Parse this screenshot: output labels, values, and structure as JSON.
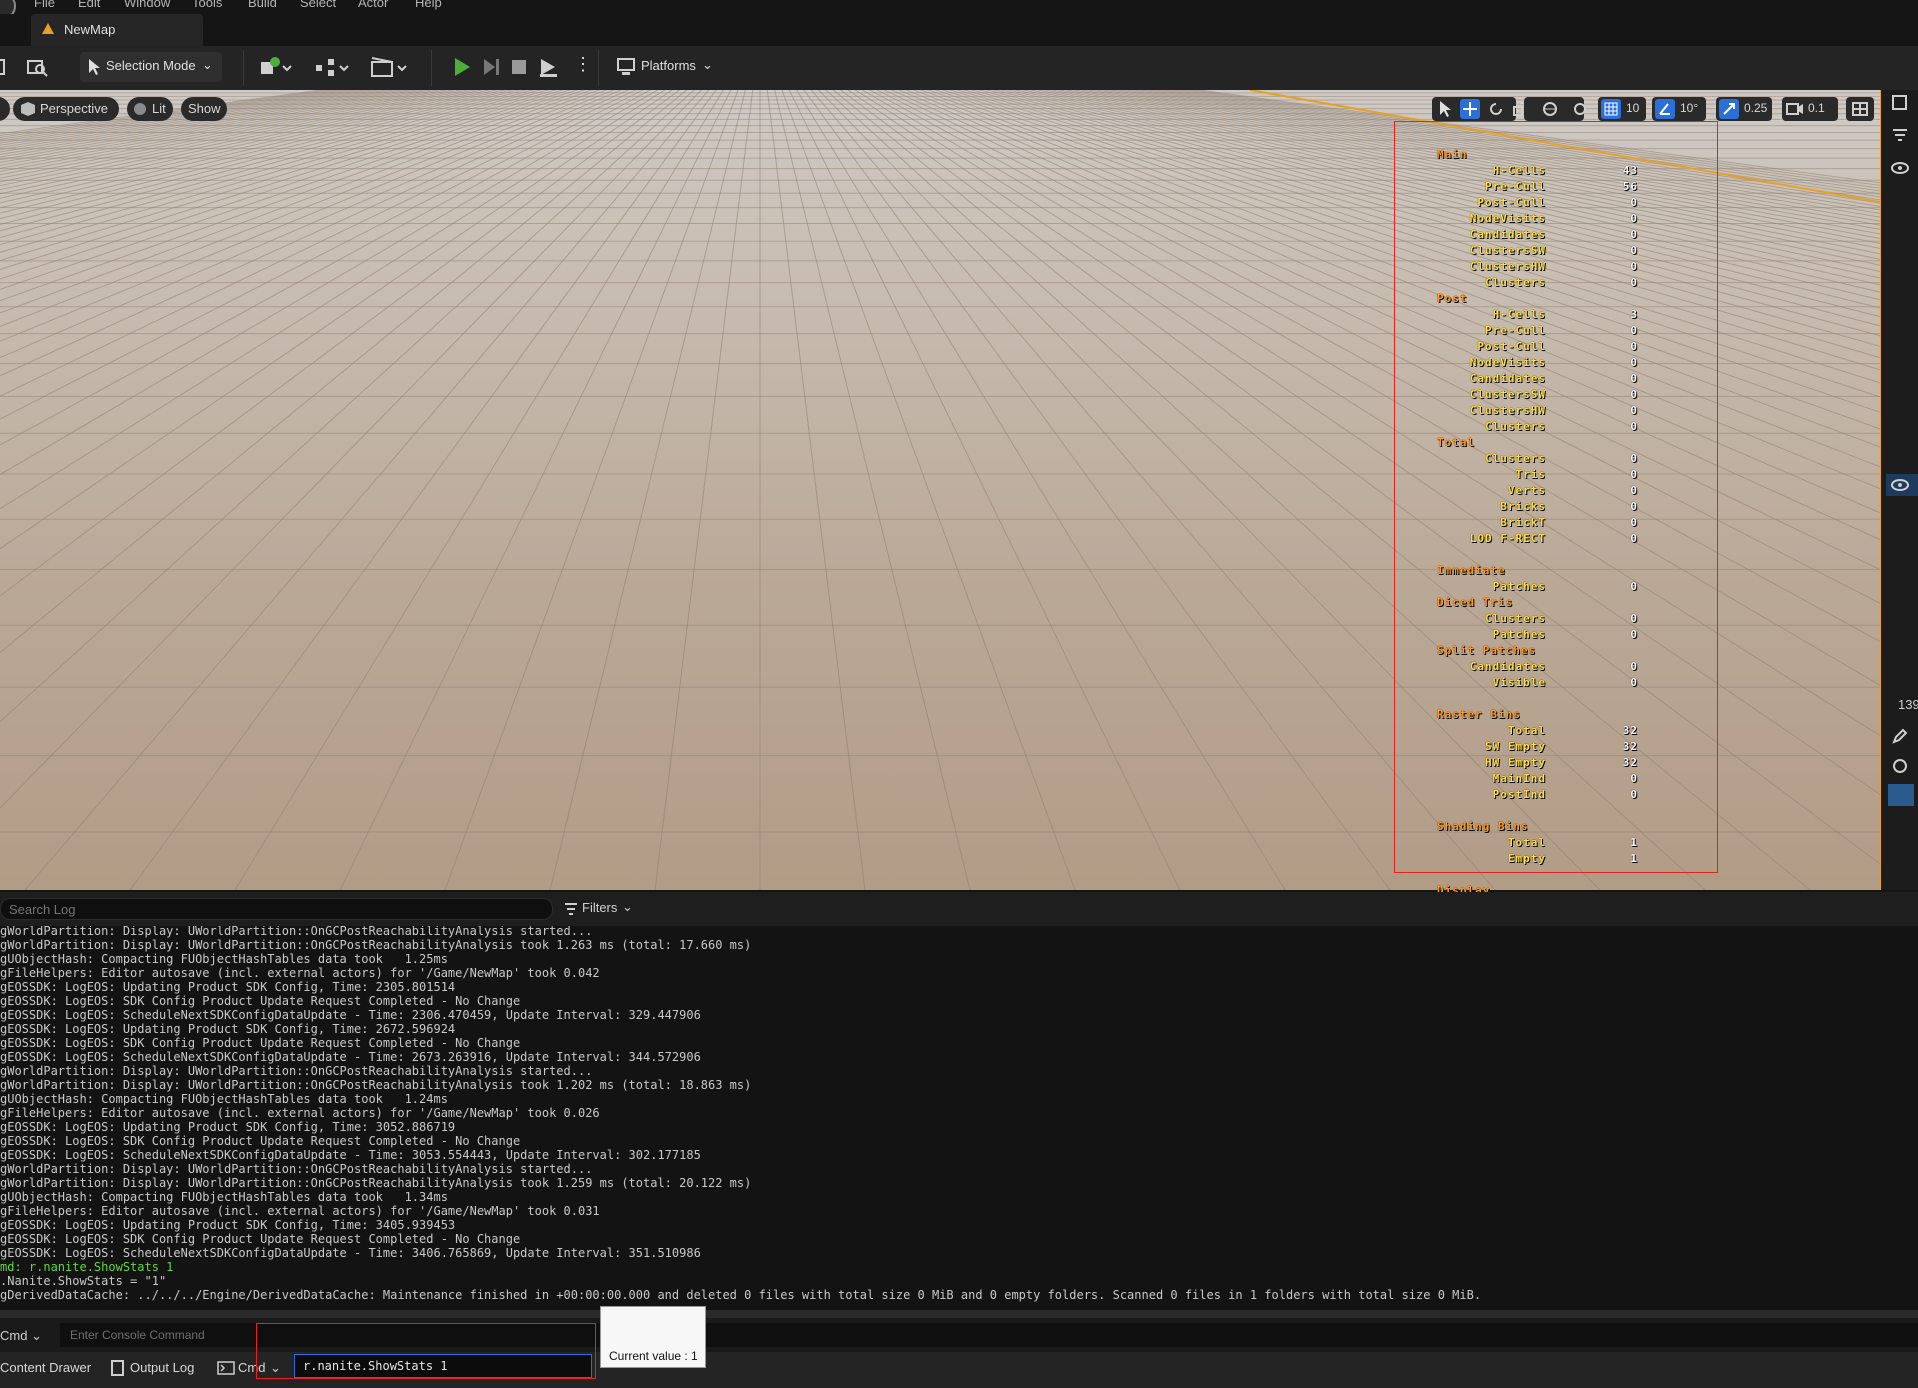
{
  "menu": [
    "File",
    "Edit",
    "Window",
    "Tools",
    "Build",
    "Select",
    "Actor",
    "Help"
  ],
  "tab": {
    "title": "NewMap"
  },
  "toolbar": {
    "selection_mode": "Selection Mode",
    "platforms": "Platforms"
  },
  "viewport": {
    "perspective": "Perspective",
    "lit": "Lit",
    "show": "Show",
    "grid_snap": "10",
    "rotation_snap": "10°",
    "scale_snap": "0.25",
    "camera_speed": "0.1",
    "right_edge_value": "139"
  },
  "stats": [
    {
      "type": "section",
      "label": "Main"
    },
    {
      "type": "row",
      "label": "H-Cells",
      "value": "43"
    },
    {
      "type": "row",
      "label": "Pre-Cull",
      "value": "56"
    },
    {
      "type": "row",
      "label": "Post-Cull",
      "value": "0"
    },
    {
      "type": "row",
      "label": "NodeVisits",
      "value": "0"
    },
    {
      "type": "row",
      "label": "Candidates",
      "value": "0"
    },
    {
      "type": "row",
      "label": "ClustersSW",
      "value": "0"
    },
    {
      "type": "row",
      "label": "ClustersHW",
      "value": "0"
    },
    {
      "type": "row",
      "label": "Clusters",
      "value": "0"
    },
    {
      "type": "section",
      "label": "Post"
    },
    {
      "type": "row",
      "label": "H-Cells",
      "value": "3"
    },
    {
      "type": "row",
      "label": "Pre-Cull",
      "value": "0"
    },
    {
      "type": "row",
      "label": "Post-Cull",
      "value": "0"
    },
    {
      "type": "row",
      "label": "NodeVisits",
      "value": "0"
    },
    {
      "type": "row",
      "label": "Candidates",
      "value": "0"
    },
    {
      "type": "row",
      "label": "ClustersSW",
      "value": "0"
    },
    {
      "type": "row",
      "label": "ClustersHW",
      "value": "0"
    },
    {
      "type": "row",
      "label": "Clusters",
      "value": "0"
    },
    {
      "type": "section",
      "label": "Total"
    },
    {
      "type": "row",
      "label": "Clusters",
      "value": "0"
    },
    {
      "type": "row",
      "label": "Tris",
      "value": "0"
    },
    {
      "type": "row",
      "label": "Verts",
      "value": "0"
    },
    {
      "type": "row",
      "label": "Bricks",
      "value": "0"
    },
    {
      "type": "row",
      "label": "BrickT",
      "value": "0"
    },
    {
      "type": "row",
      "label": "LOD F-RECT",
      "value": "0"
    },
    {
      "type": "gap"
    },
    {
      "type": "section",
      "label": "Immediate"
    },
    {
      "type": "row",
      "label": "Patches",
      "value": "0"
    },
    {
      "type": "section",
      "label": "Diced Tris"
    },
    {
      "type": "row",
      "label": "Clusters",
      "value": "0"
    },
    {
      "type": "row",
      "label": "Patches",
      "value": "0"
    },
    {
      "type": "section",
      "label": "Split Patches"
    },
    {
      "type": "row",
      "label": "Candidates",
      "value": "0"
    },
    {
      "type": "row",
      "label": "Visible",
      "value": "0"
    },
    {
      "type": "gap"
    },
    {
      "type": "section",
      "label": "Raster Bins"
    },
    {
      "type": "row",
      "label": "Total",
      "value": "32"
    },
    {
      "type": "row",
      "label": "SW Empty",
      "value": "32"
    },
    {
      "type": "row",
      "label": "HW Empty",
      "value": "32"
    },
    {
      "type": "row",
      "label": "MainInd",
      "value": "0"
    },
    {
      "type": "row",
      "label": "PostInd",
      "value": "0"
    },
    {
      "type": "gap"
    },
    {
      "type": "section",
      "label": "Shading Bins"
    },
    {
      "type": "row",
      "label": "Total",
      "value": "1"
    },
    {
      "type": "row",
      "label": "Empty",
      "value": "1"
    },
    {
      "type": "gap"
    },
    {
      "type": "section",
      "label": "Display"
    }
  ],
  "log": {
    "search_placeholder": "Search Log",
    "filters": "Filters",
    "lines": [
      "gWorldPartition: Display: UWorldPartition::OnGCPostReachabilityAnalysis started...",
      "gWorldPartition: Display: UWorldPartition::OnGCPostReachabilityAnalysis took 1.263 ms (total: 17.660 ms)",
      "gUObjectHash: Compacting FUObjectHashTables data took   1.25ms",
      "gFileHelpers: Editor autosave (incl. external actors) for '/Game/NewMap' took 0.042",
      "gEOSSDK: LogEOS: Updating Product SDK Config, Time: 2305.801514",
      "gEOSSDK: LogEOS: SDK Config Product Update Request Completed - No Change",
      "gEOSSDK: LogEOS: ScheduleNextSDKConfigDataUpdate - Time: 2306.470459, Update Interval: 329.447906",
      "gEOSSDK: LogEOS: Updating Product SDK Config, Time: 2672.596924",
      "gEOSSDK: LogEOS: SDK Config Product Update Request Completed - No Change",
      "gEOSSDK: LogEOS: ScheduleNextSDKConfigDataUpdate - Time: 2673.263916, Update Interval: 344.572906",
      "gWorldPartition: Display: UWorldPartition::OnGCPostReachabilityAnalysis started...",
      "gWorldPartition: Display: UWorldPartition::OnGCPostReachabilityAnalysis took 1.202 ms (total: 18.863 ms)",
      "gUObjectHash: Compacting FUObjectHashTables data took   1.24ms",
      "gFileHelpers: Editor autosave (incl. external actors) for '/Game/NewMap' took 0.026",
      "gEOSSDK: LogEOS: Updating Product SDK Config, Time: 3052.886719",
      "gEOSSDK: LogEOS: SDK Config Product Update Request Completed - No Change",
      "gEOSSDK: LogEOS: ScheduleNextSDKConfigDataUpdate - Time: 3053.554443, Update Interval: 302.177185",
      "gWorldPartition: Display: UWorldPartition::OnGCPostReachabilityAnalysis started...",
      "gWorldPartition: Display: UWorldPartition::OnGCPostReachabilityAnalysis took 1.259 ms (total: 20.122 ms)",
      "gUObjectHash: Compacting FUObjectHashTables data took   1.34ms",
      "gFileHelpers: Editor autosave (incl. external actors) for '/Game/NewMap' took 0.031",
      "gEOSSDK: LogEOS: Updating Product SDK Config, Time: 3405.939453",
      "gEOSSDK: LogEOS: SDK Config Product Update Request Completed - No Change",
      "gEOSSDK: LogEOS: ScheduleNextSDKConfigDataUpdate - Time: 3406.765869, Update Interval: 351.510986",
      "md: r.nanite.ShowStats 1",
      ".Nanite.ShowStats = \"1\"",
      "gDerivedDataCache: ../../../Engine/DerivedDataCache: Maintenance finished in +00:00:00.000 and deleted 0 files with total size 0 MiB and 0 empty folders. Scanned 0 files in 1 folders with total size 0 MiB."
    ]
  },
  "console": {
    "selector": "Cmd",
    "placeholder": "Enter Console Command"
  },
  "statusbar": {
    "content_drawer": "Content Drawer",
    "output_log": "Output Log",
    "cmd": "Cmd",
    "cmd_value": "r.nanite.ShowStats 1",
    "tooltip": "Current value : 1"
  },
  "colors": {
    "accent": "#e8a024",
    "play": "#4caf3a",
    "stat_header": "#ff9a1a",
    "stat_label": "#ffe040",
    "highlight_box": "#e82020"
  }
}
